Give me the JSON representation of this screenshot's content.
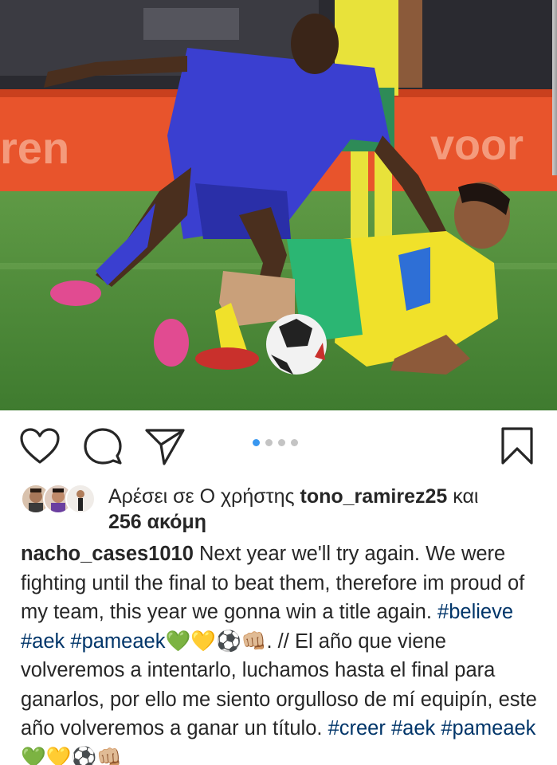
{
  "post": {
    "photo_description": "",
    "carousel": {
      "count": 4,
      "active_index": 0
    }
  },
  "actions": {
    "like_icon": "heart-icon",
    "comment_icon": "comment-icon",
    "share_icon": "paper-plane-icon",
    "save_icon": "bookmark-icon"
  },
  "likes": {
    "prefix": "Αρέσει σε Ο χρήστης",
    "user": "tono_ramirez25",
    "conj": "και",
    "others": "256 ακόμη"
  },
  "caption": {
    "username": "nacho_cases1010",
    "text_en": "Next year we'll try again. We were fighting until the final to beat them, therefore im proud of my team, this year we gonna win a title again.",
    "tags_en": [
      "#believe",
      "#aek",
      "#pameaek"
    ],
    "emoji_en": "💚💛⚽👊🏼",
    "separator": ". //",
    "text_es": "El año que viene volveremos a intentarlo, luchamos hasta el final para ganarlos, por ello me siento orgulloso de mí equipín, este año volveremos a ganar un título.",
    "tags_es": [
      "#creer",
      "#aek",
      "#pameaek"
    ],
    "emoji_es": "💚💛⚽👊🏼"
  },
  "colors": {
    "text": "#262626",
    "hashtag": "#003569",
    "dot_active": "#3897f0",
    "dot_inactive": "#c4c4c4"
  }
}
